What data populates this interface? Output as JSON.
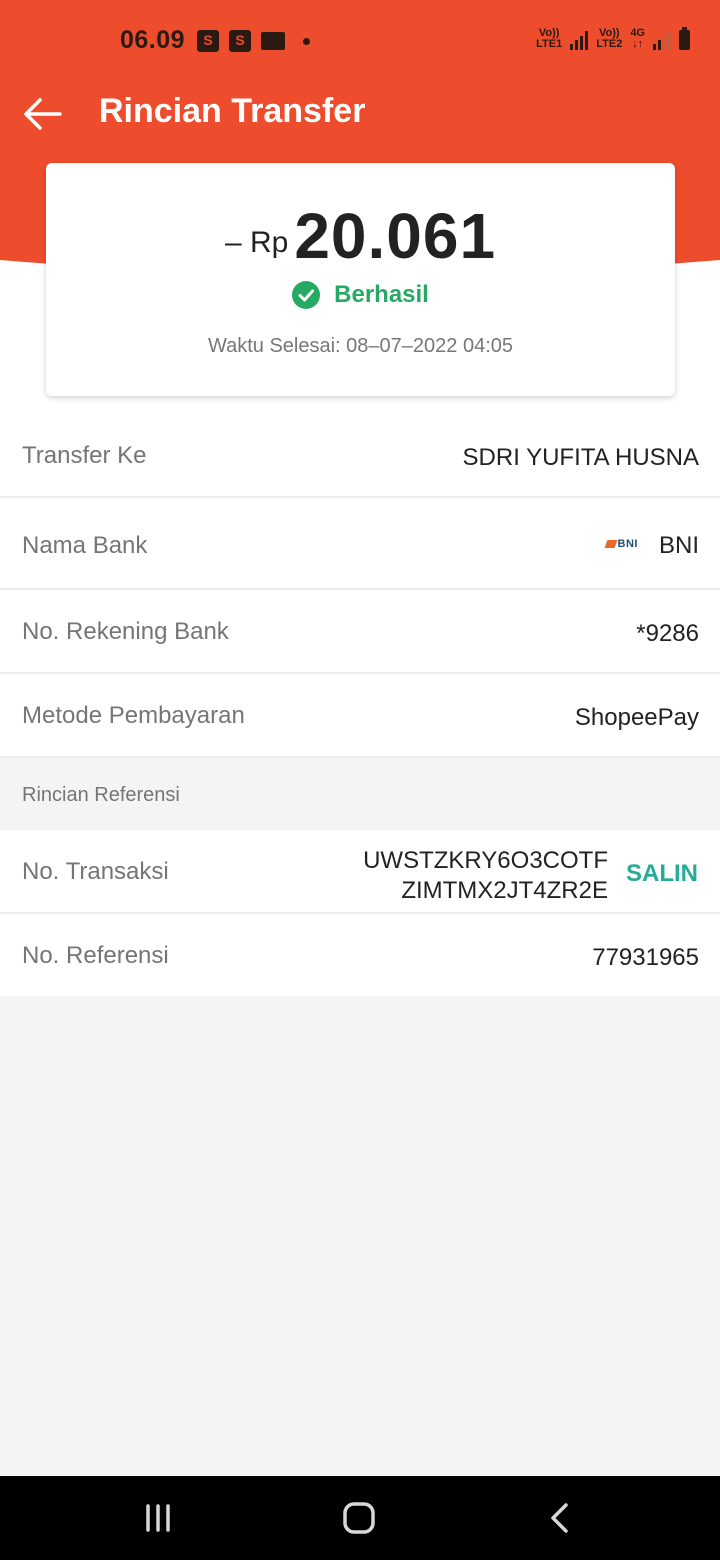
{
  "status_bar": {
    "time": "06.09",
    "sim1_top": "Vo))",
    "sim1_bottom": "LTE1",
    "sim2_top": "Vo))",
    "sim2_bottom": "LTE2",
    "network": "4G"
  },
  "header": {
    "title": "Rincian Transfer",
    "back_icon": "arrow-left-icon"
  },
  "summary": {
    "amount_prefix": "– Rp",
    "amount": "20.061",
    "status": "Berhasil",
    "status_icon": "check-circle-icon",
    "completed_time": "Waktu Selesai: 08–07–2022 04:05"
  },
  "details": [
    {
      "label": "Transfer Ke",
      "value": "SDRI YUFITA  HUSNA"
    },
    {
      "label": "Nama Bank",
      "value": "BNI",
      "logo_text": "BNI"
    },
    {
      "label": "No. Rekening Bank",
      "value": "*9286"
    },
    {
      "label": "Metode Pembayaran",
      "value": "ShopeePay"
    }
  ],
  "reference": {
    "section_title": "Rincian Referensi",
    "transaction_label": "No. Transaksi",
    "transaction_line1": "UWSTZKRY6O3COTF",
    "transaction_line2": "ZIMTMX2JT4ZR2E",
    "copy_label": "SALIN",
    "reference_label": "No. Referensi",
    "reference_value": "77931965"
  },
  "colors": {
    "brand": "#ee4d2d",
    "success": "#26aa63",
    "copy": "#26aa99"
  },
  "nav": {
    "recent_icon": "recent-apps-icon",
    "home_icon": "home-icon",
    "back_icon": "back-icon"
  }
}
